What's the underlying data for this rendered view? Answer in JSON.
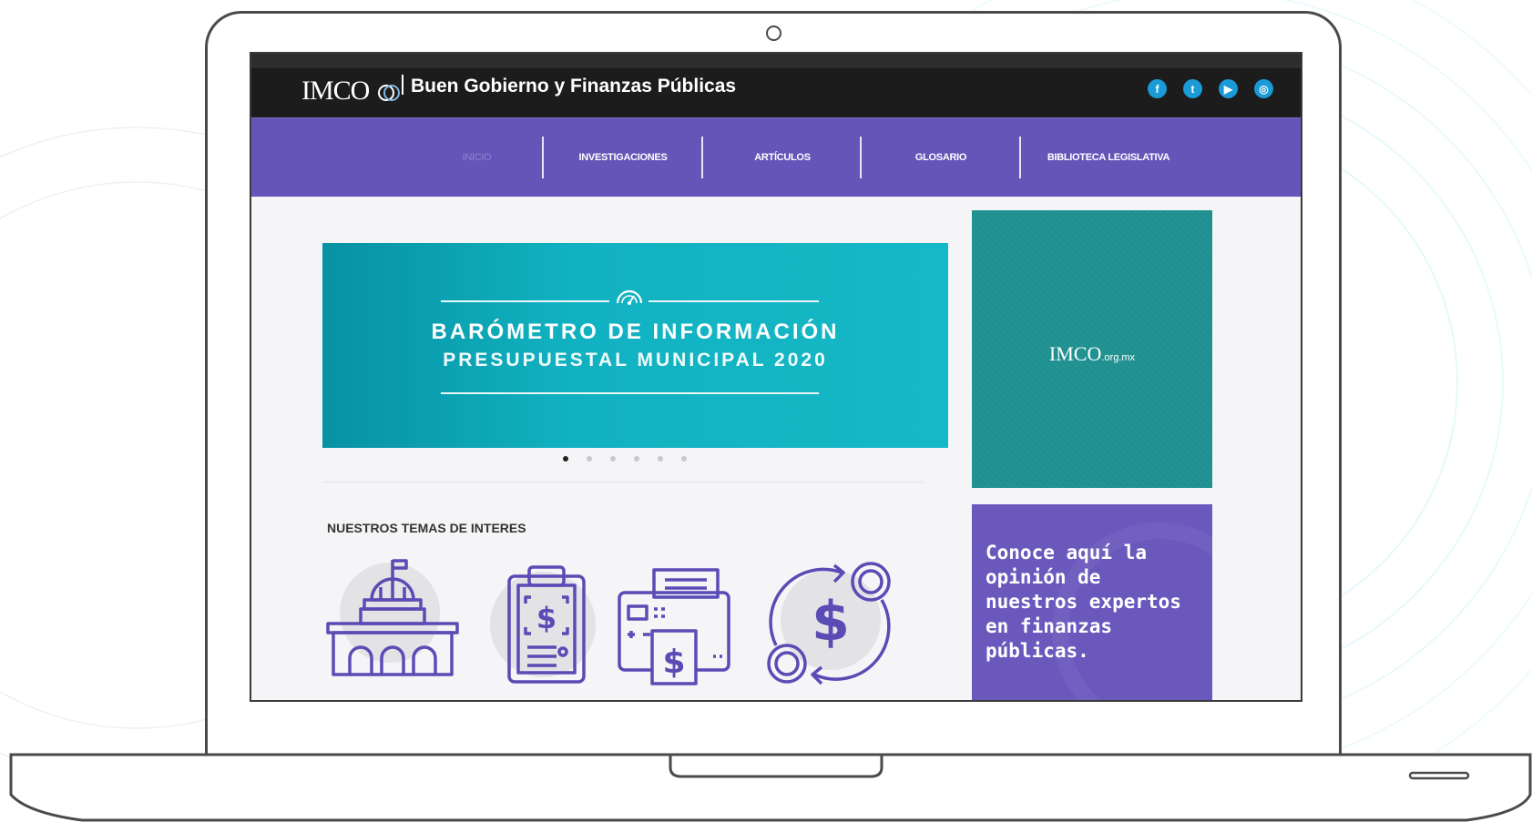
{
  "header": {
    "logo_text": "IMCO",
    "site_title": "Buen Gobierno y Finanzas Públicas",
    "social": [
      {
        "icon": "facebook-icon",
        "glyph": "f"
      },
      {
        "icon": "twitter-icon",
        "glyph": "t"
      },
      {
        "icon": "youtube-icon",
        "glyph": "▶"
      },
      {
        "icon": "instagram-icon",
        "glyph": "◎"
      }
    ]
  },
  "nav": {
    "items": [
      {
        "label": "INICIO"
      },
      {
        "label": "INVESTIGACIONES"
      },
      {
        "label": "ARTÍCULOS"
      },
      {
        "label": "GLOSARIO"
      },
      {
        "label": "BIBLIOTECA LEGISLATIVA"
      }
    ]
  },
  "hero": {
    "line1": "BARÓMETRO DE INFORMACIÓN",
    "line2": "PRESUPUESTAL MUNICIPAL 2020",
    "slide_count": 6,
    "active_slide": 1
  },
  "topics": {
    "title": "NUESTROS TEMAS DE INTERES",
    "icons": [
      "government-building-icon",
      "budget-clipboard-icon",
      "payment-printer-icon",
      "money-exchange-icon"
    ]
  },
  "sidebar": {
    "ad_logo": "IMCO",
    "ad_domain": ".org.mx",
    "promo_text": "Conoce aquí la opinión de nuestros expertos en finanzas públicas."
  },
  "colors": {
    "nav_bg": "#6555b8",
    "hero_bg": "#12b3c2",
    "ad_bg": "#1f9090",
    "promo_bg": "#6a58bd",
    "topbar_bg": "#1c1c1c"
  }
}
